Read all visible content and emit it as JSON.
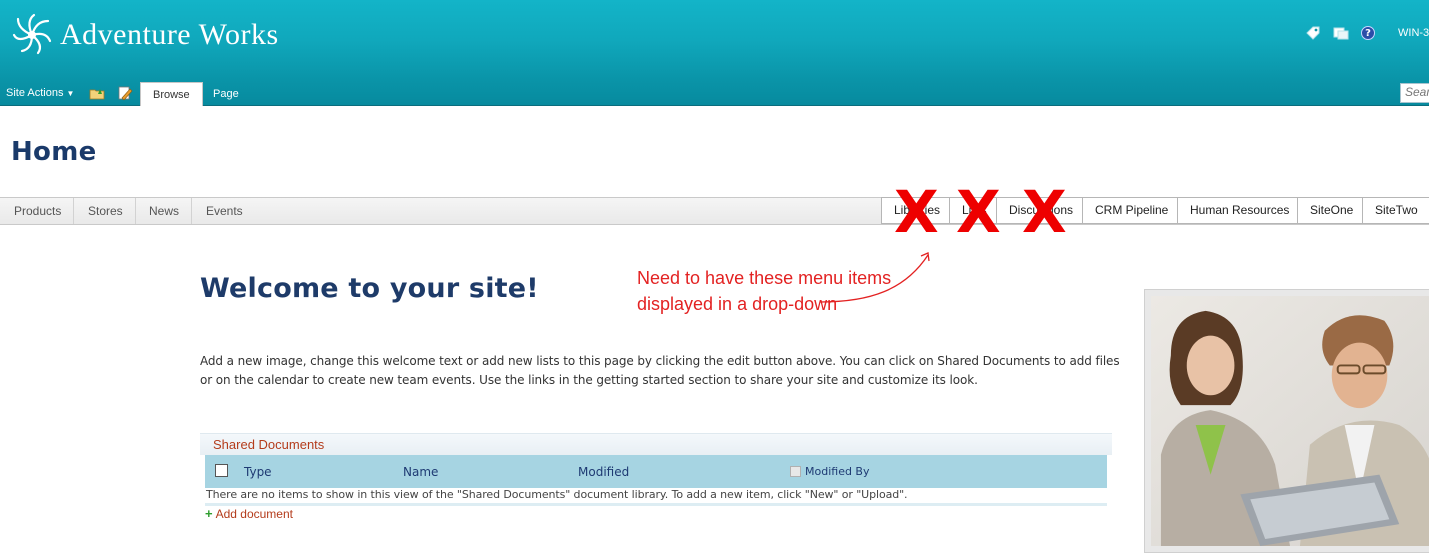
{
  "header": {
    "site_title": "Adventure Works",
    "user_name": "WIN-3",
    "help_symbol": "?",
    "colors": {
      "banner": "#10a8bc",
      "title_blue": "#1a3a6a",
      "link_red": "#b43c1c",
      "annotation_red": "#e32222"
    }
  },
  "ribbon": {
    "site_actions_label": "Site Actions",
    "tabs": [
      {
        "label": "Browse",
        "active": true
      },
      {
        "label": "Page",
        "active": false
      }
    ],
    "search_placeholder": "Search"
  },
  "page": {
    "title": "Home"
  },
  "topnav": {
    "left_items": [
      "Products",
      "Stores",
      "News",
      "Events"
    ],
    "right_items": [
      "Libraries",
      "Lists",
      "Discussions",
      "CRM Pipeline",
      "Human Resources",
      "SiteOne",
      "SiteTwo"
    ]
  },
  "annotation": {
    "mark": "X",
    "text": "Need to have these menu items displayed in a drop-down"
  },
  "content": {
    "welcome_heading": "Welcome to your site!",
    "intro_text": "Add a new image, change this welcome text or add new lists to this page by clicking the edit button above. You can click on Shared Documents to add files or on the calendar to create new team events. Use the links in the getting started section to share your site and customize its look."
  },
  "shared_documents": {
    "title": "Shared Documents",
    "columns": [
      "Type",
      "Name",
      "Modified",
      "Modified By"
    ],
    "empty_message": "There are no items to show in this view of the \"Shared Documents\" document library. To add a new item, click \"New\" or \"Upload\".",
    "add_label": "Add document",
    "add_symbol": "+"
  }
}
